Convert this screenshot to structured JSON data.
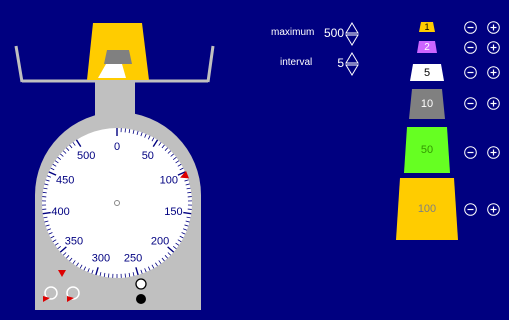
{
  "controls": {
    "maximum": {
      "label": "maximum",
      "value": "500"
    },
    "interval": {
      "label": "interval",
      "value": "5"
    }
  },
  "dial": {
    "labels": [
      "0",
      "50",
      "100",
      "150",
      "200",
      "250",
      "300",
      "350",
      "400",
      "450",
      "500"
    ],
    "max": 500,
    "interval": 5,
    "pointer_value": 104,
    "tick_color": "#000080",
    "label_color": "#000080"
  },
  "weights": [
    {
      "label": "1",
      "color": "#ffcc00",
      "text_color": "#000000"
    },
    {
      "label": "2",
      "color": "#cc66ff",
      "text_color": "#ffffff"
    },
    {
      "label": "5",
      "color": "#ffffff",
      "text_color": "#000000"
    },
    {
      "label": "10",
      "color": "#808080",
      "text_color": "#ffffff"
    },
    {
      "label": "50",
      "color": "#66ff22",
      "text_color": "#339900"
    },
    {
      "label": "100",
      "color": "#ffcc00",
      "text_color": "#808080"
    }
  ],
  "colors": {
    "background": "#000080",
    "scale_body": "#c0c0c0",
    "pan": "#c0c0c0",
    "marker": "#dd0000"
  },
  "icons": {
    "minus": "minus-circle-icon",
    "plus": "plus-circle-icon",
    "spinner": "up-down-spinner-icon",
    "rotate_left": "rotate-left-icon",
    "rotate_right": "rotate-right-icon"
  }
}
